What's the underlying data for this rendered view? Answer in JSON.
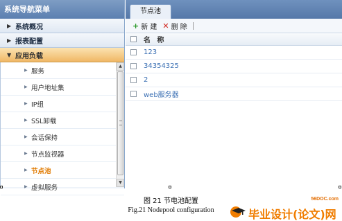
{
  "sidebar": {
    "title": "系统导航菜单",
    "groups": [
      {
        "label": "系统概况"
      },
      {
        "label": "报表配置"
      },
      {
        "label": "应用负载"
      }
    ],
    "subitems": [
      {
        "label": "服务"
      },
      {
        "label": "用户地址集"
      },
      {
        "label": "IP组"
      },
      {
        "label": "SSL卸载"
      },
      {
        "label": "会话保持"
      },
      {
        "label": "节点监视器"
      },
      {
        "label": "节点池"
      },
      {
        "label": "虚拟服务"
      }
    ]
  },
  "main": {
    "tab_label": "节点池",
    "toolbar": {
      "add_label": "新 建",
      "delete_label": "删 除"
    },
    "table": {
      "header": "名 称",
      "rows": [
        "123",
        "34354325",
        "2",
        "web服务器"
      ]
    }
  },
  "caption": {
    "cn": "图 21  节电池配置",
    "en": "Fig.21 Nodepool configuration"
  },
  "watermark": {
    "site": "56DOC.com",
    "brand": "毕业设计(论文)网"
  },
  "colors": {
    "header_blue": "#5b7fb0",
    "active_orange": "#e07a00",
    "link_blue": "#3a6fb3",
    "add_green": "#2b9a2b",
    "delete_red": "#d0261d"
  }
}
